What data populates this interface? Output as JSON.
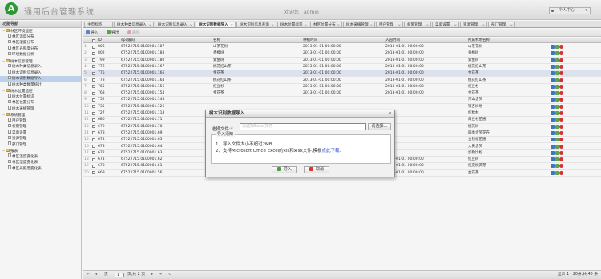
{
  "app": {
    "logo_letter": "A",
    "title": "通用后台管理系统",
    "welcome": "欢迎您，admin",
    "user_menu": "个人中心"
  },
  "sidebar": {
    "title": "功能导航",
    "items": [
      {
        "label": "林区环境监控",
        "kind": "folder",
        "level": 0,
        "toggle": "−"
      },
      {
        "label": "林区温度分布",
        "kind": "doc",
        "level": 1
      },
      {
        "label": "林区湿度分布",
        "kind": "doc",
        "level": 1
      },
      {
        "label": "林区光照度分布",
        "kind": "doc",
        "level": 1
      },
      {
        "label": "环境数据分析",
        "kind": "doc",
        "level": 1
      },
      {
        "label": "树木信息管理",
        "kind": "folder",
        "level": 0,
        "toggle": "−"
      },
      {
        "label": "树木种类信息录入",
        "kind": "doc",
        "level": 1
      },
      {
        "label": "树木识别信息录入",
        "kind": "doc",
        "level": 1
      },
      {
        "label": "树木识别数据导入",
        "kind": "doc",
        "level": 1,
        "selected": true
      },
      {
        "label": "树木种类数量统计",
        "kind": "doc",
        "level": 1
      },
      {
        "label": "树木位置监控",
        "kind": "folder",
        "level": 0,
        "toggle": "−"
      },
      {
        "label": "树木位置标识",
        "kind": "doc",
        "level": 1
      },
      {
        "label": "林区位置分布",
        "kind": "doc",
        "level": 1
      },
      {
        "label": "树木采摘管理",
        "kind": "doc",
        "level": 1
      },
      {
        "label": "系统管理",
        "kind": "folder",
        "level": 0,
        "toggle": "−"
      },
      {
        "label": "用户管理",
        "kind": "doc",
        "level": 1
      },
      {
        "label": "权限管理",
        "kind": "doc",
        "level": 1
      },
      {
        "label": "菜单设置",
        "kind": "doc",
        "level": 1
      },
      {
        "label": "资源管理",
        "kind": "doc",
        "level": 1
      },
      {
        "label": "部门管理",
        "kind": "doc",
        "level": 1
      },
      {
        "label": "报表",
        "kind": "folder",
        "level": 0,
        "toggle": "−"
      },
      {
        "label": "林区温度变化表",
        "kind": "doc",
        "level": 1
      },
      {
        "label": "林区湿度变化表",
        "kind": "doc",
        "level": 1
      },
      {
        "label": "林区光照度变化表",
        "kind": "doc",
        "level": 1
      }
    ]
  },
  "tabs": [
    {
      "label": "主页标签",
      "active": false
    },
    {
      "label": "树木种类信息录入",
      "active": false
    },
    {
      "label": "树木识别信息录入",
      "active": false
    },
    {
      "label": "树木识别数据导入",
      "active": true
    },
    {
      "label": "树木识别信息查询",
      "active": false
    },
    {
      "label": "树木位置标识",
      "active": false
    },
    {
      "label": "林区位置分布",
      "active": false
    },
    {
      "label": "树木采摘管理",
      "active": false
    },
    {
      "label": "用户管理",
      "active": false
    },
    {
      "label": "权限管理",
      "active": false
    },
    {
      "label": "菜单设置",
      "active": false
    },
    {
      "label": "资源管理",
      "active": false
    },
    {
      "label": "部门管理",
      "active": false
    }
  ],
  "toolbar": {
    "import": "导入",
    "export": "导出",
    "delete": "删除"
  },
  "grid": {
    "columns": [
      "ID",
      "epc编码",
      "名称",
      "种植时间",
      "入园时间",
      "所属林地名称"
    ],
    "rows": [
      [
        "806",
        "67522715.0100001.187",
        "山茶花树",
        "2013-01-01 00:00:00",
        "2013-01-01 00:00:00",
        "山茶花树"
      ],
      [
        "802",
        "67522715.0100001.183",
        "香樟树",
        "2013-01-01 00:00:00",
        "2013-01-01 00:00:00",
        "香樟树"
      ],
      [
        "799",
        "67522715.0100001.180",
        "紫金树",
        "2013-01-01 00:00:00",
        "2013-01-01 00:00:00",
        "紫金树"
      ],
      [
        "776",
        "67522715.0100001.167",
        "桃花红山茶",
        "2013-01-01 00:00:00",
        "2013-01-01 00:00:00",
        "桃花红山茶"
      ],
      [
        "775",
        "67522715.0100001.166",
        "金花茶",
        "2013-01-01 00:00:00",
        "2013-01-01 00:00:00",
        "金花茶"
      ],
      [
        "773",
        "67522715.0100001.164",
        "桃花红山茶",
        "2013-01-01 00:00:00",
        "2013-01-01 00:00:00",
        "桃花红山茶"
      ],
      [
        "765",
        "67522715.0100001.156",
        "红豆杉",
        "2013-01-01 00:00:00",
        "2013-01-01 00:00:00",
        "红豆杉"
      ],
      [
        "763",
        "67522715.0100001.154",
        "金花茶",
        "2013-01-01 00:00:00",
        "2013-01-01 00:00:00",
        "金花茶"
      ],
      [
        "752",
        "67522715.0100001.143",
        "",
        "",
        "",
        "深山含笑"
      ],
      [
        "735",
        "67522715.0100001.126",
        "",
        "",
        "",
        "银杏树地"
      ],
      [
        "727",
        "67522715.0100001.118",
        "",
        "",
        "",
        "红松林"
      ],
      [
        "680",
        "67522715.0100001.71",
        "",
        "",
        "",
        "白豆杉苗圃"
      ],
      [
        "679",
        "67522715.0100001.70",
        "",
        "",
        "",
        "桃花树"
      ],
      [
        "678",
        "67522715.0100001.69",
        "",
        "",
        "",
        "四季含笑花卉"
      ],
      [
        "674",
        "67522715.0100001.65",
        "",
        "",
        "",
        "金钱松苗圃"
      ],
      [
        "673",
        "67522715.0100001.64",
        "",
        "",
        "",
        "大黄含笑"
      ],
      [
        "672",
        "67522715.0100001.63",
        "",
        "",
        "",
        "加勒比松"
      ],
      [
        "671",
        "67522715.0100001.62",
        "红豆树",
        "2013-01-01 00:00:00",
        "2013-01-01 00:00:00",
        "红豆树"
      ],
      [
        "670",
        "67522715.0100001.61",
        "红皮桃黄芽",
        "2013-01-01 00:00:00",
        "2013-01-01 00:00:00",
        "红皮桃黄芽"
      ],
      [
        "669",
        "67522715.0100001.56",
        "金花茶",
        "2013-01-01 00:00:00",
        "2013-01-01 00:00:00",
        "金花茶"
      ]
    ]
  },
  "pager": {
    "page_value": "1",
    "before": "页",
    "of_text": "页,共 2 页",
    "summary": "显示 1 - 20条,共 40 条",
    "first": "⇤",
    "prev": "◂",
    "next": "▸",
    "last": "⇥",
    "refresh": "↻"
  },
  "dialog": {
    "title": "树木识别数据导入",
    "close": "×",
    "file_label": "选择文件:*",
    "file_placeholder": "请选择Excel文件",
    "browse": "请选择...",
    "notes_legend": "导入须知",
    "note1": "1、导入文件大小不超过2MB.",
    "note2_prefix": "2、支持Microsoft Office Excel的xls和xlsx文件,模板",
    "note2_link": "点此下载",
    "note2_suffix": ".",
    "ok": "导入",
    "cancel": "取消"
  },
  "colors": {
    "accent": "#2e9e3a",
    "selection": "#c5d9f3",
    "error_border": "#e06060",
    "link": "#1a3fcf"
  }
}
